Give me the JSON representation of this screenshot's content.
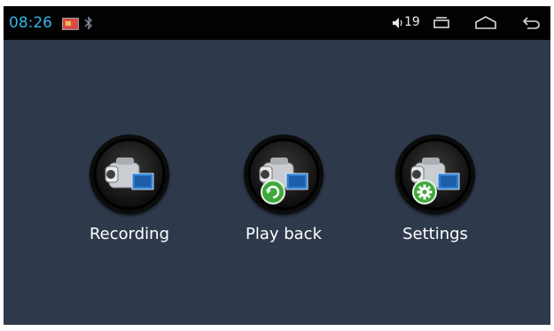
{
  "status_bar": {
    "time": "08:26",
    "volume_level": "19",
    "icons": [
      "sd-card-icon",
      "bluetooth-icon",
      "volume-icon",
      "recent-apps-icon",
      "home-icon",
      "back-icon"
    ]
  },
  "apps": [
    {
      "label": "Recording",
      "icon": "camcorder-icon"
    },
    {
      "label": "Play back",
      "icon": "camcorder-playback-icon"
    },
    {
      "label": "Settings",
      "icon": "camcorder-settings-icon"
    }
  ],
  "colors": {
    "status_bar_bg": "#020202",
    "clock": "#33b5e5",
    "screen_bg": "#2e3a4c",
    "badge_green": "#3fa83b"
  }
}
